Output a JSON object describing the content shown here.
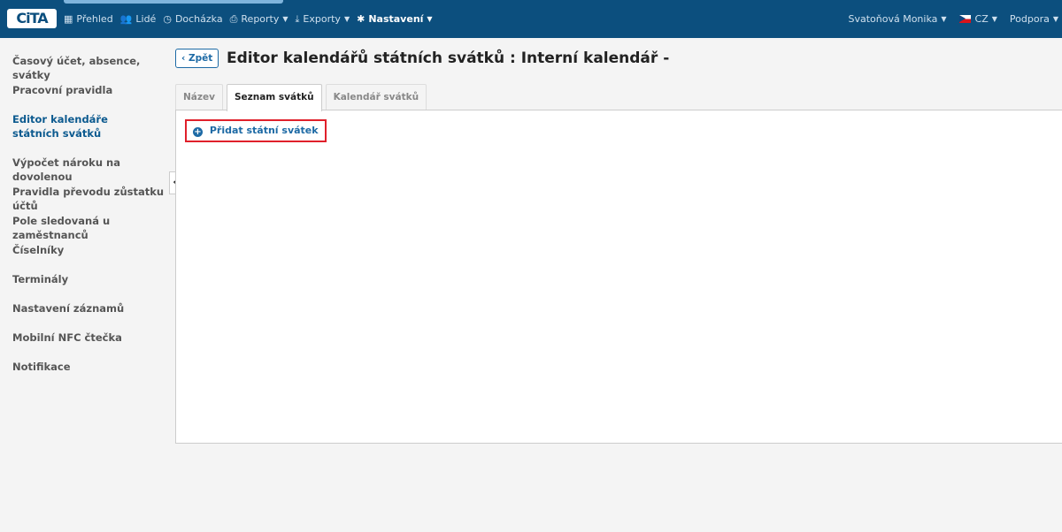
{
  "app": {
    "logo_text": "CiTA"
  },
  "topnav": {
    "items": [
      {
        "label": "Přehled",
        "icon": "grid-icon"
      },
      {
        "label": "Lidé",
        "icon": "people-icon"
      },
      {
        "label": "Docházka",
        "icon": "clock-icon"
      },
      {
        "label": "Reporty",
        "icon": "printer-icon"
      },
      {
        "label": "Exporty",
        "icon": "export-icon"
      },
      {
        "label": "Nastavení",
        "icon": "gear-icon"
      }
    ],
    "user": "Svatoňová Monika",
    "language": "CZ",
    "support": "Podpora"
  },
  "sidebar": {
    "items": [
      {
        "label": "Časový účet, absence, svátky"
      },
      {
        "label": "Pracovní pravidla"
      },
      {
        "label": "Editor kalendáře státních svátků"
      },
      {
        "label": "Výpočet nároku na dovolenou"
      },
      {
        "label": "Pravidla převodu zůstatku účtů"
      },
      {
        "label": "Pole sledovaná u zaměstnanců"
      },
      {
        "label": "Číselníky"
      },
      {
        "label": "Terminály"
      },
      {
        "label": "Nastavení záznamů"
      },
      {
        "label": "Mobilní NFC čtečka"
      },
      {
        "label": "Notifikace"
      }
    ],
    "active_index": 2
  },
  "main": {
    "back_label": "Zpět",
    "title": "Editor kalendářů státních svátků : Interní kalendář -",
    "tabs": [
      {
        "label": "Název"
      },
      {
        "label": "Seznam svátků"
      },
      {
        "label": "Kalendář svátků"
      }
    ],
    "active_tab": 1,
    "add_holiday_label": "Přidat státní svátek"
  },
  "colors": {
    "topbar": "#0c4f7e",
    "accent": "#1d6aa5",
    "highlight_border": "#e0202b"
  }
}
